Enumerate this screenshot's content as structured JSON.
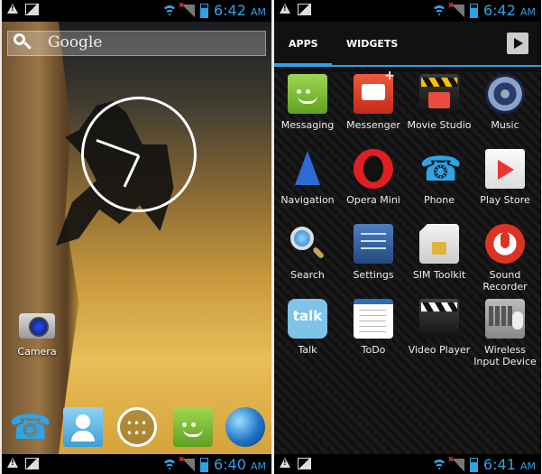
{
  "status_bars": {
    "left_top_time": "6:42",
    "left_top_ampm": "AM",
    "right_top_time": "6:42",
    "right_top_ampm": "AM",
    "left_bottom_time": "6:40",
    "left_bottom_ampm": "AM",
    "right_bottom_time": "6:41",
    "right_bottom_ampm": "AM"
  },
  "home": {
    "search_label": "Google",
    "camera_label": "Camera",
    "dock": [
      "phone-icon",
      "contacts-icon",
      "all-apps-icon",
      "messaging-icon",
      "browser-globe-icon"
    ]
  },
  "drawer": {
    "tabs": {
      "apps": "APPS",
      "widgets": "WIDGETS"
    },
    "apps": [
      {
        "label": "Messaging",
        "icon": "messaging-icon"
      },
      {
        "label": "Messenger",
        "icon": "messenger-icon"
      },
      {
        "label": "Movie Studio",
        "icon": "movie-studio-icon"
      },
      {
        "label": "Music",
        "icon": "music-icon"
      },
      {
        "label": "Navigation",
        "icon": "navigation-icon"
      },
      {
        "label": "Opera Mini",
        "icon": "opera-mini-icon"
      },
      {
        "label": "Phone",
        "icon": "phone-icon"
      },
      {
        "label": "Play Store",
        "icon": "play-store-icon"
      },
      {
        "label": "Search",
        "icon": "search-icon"
      },
      {
        "label": "Settings",
        "icon": "settings-icon"
      },
      {
        "label": "SIM Toolkit",
        "icon": "sim-toolkit-icon"
      },
      {
        "label": "Sound Recorder",
        "icon": "sound-recorder-icon"
      },
      {
        "label": "Talk",
        "icon": "talk-icon"
      },
      {
        "label": "ToDo",
        "icon": "todo-icon"
      },
      {
        "label": "Video Player",
        "icon": "video-player-icon"
      },
      {
        "label": "Wireless Input Device",
        "icon": "wireless-input-icon"
      }
    ]
  },
  "colors": {
    "accent": "#2ea3e6"
  }
}
